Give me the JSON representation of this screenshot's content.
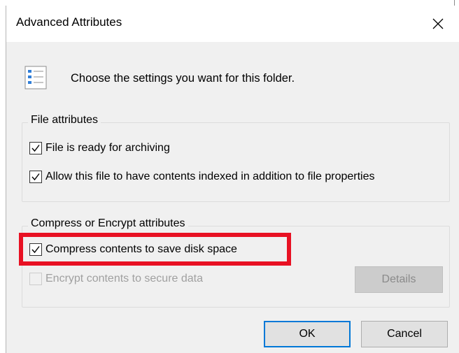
{
  "dialog": {
    "title": "Advanced Attributes",
    "close_icon": "close-icon",
    "header_icon": "attributes-list-icon",
    "header_text": "Choose the settings you want for this folder."
  },
  "file_attributes": {
    "group_label": "File attributes",
    "archive": {
      "label": "File is ready for archiving",
      "checked": true
    },
    "index": {
      "label": "Allow this file to have contents indexed in addition to file properties",
      "checked": true
    }
  },
  "compress_encrypt": {
    "group_label": "Compress or Encrypt attributes",
    "compress": {
      "label": "Compress contents to save disk space",
      "checked": true
    },
    "encrypt": {
      "label": "Encrypt contents to secure data",
      "checked": false,
      "enabled": false
    },
    "details_label": "Details"
  },
  "buttons": {
    "ok_label": "OK",
    "cancel_label": "Cancel"
  },
  "colors": {
    "highlight": "#e81123",
    "dialog_bg": "#f0f0f0",
    "default_button_border": "#0078d7"
  }
}
